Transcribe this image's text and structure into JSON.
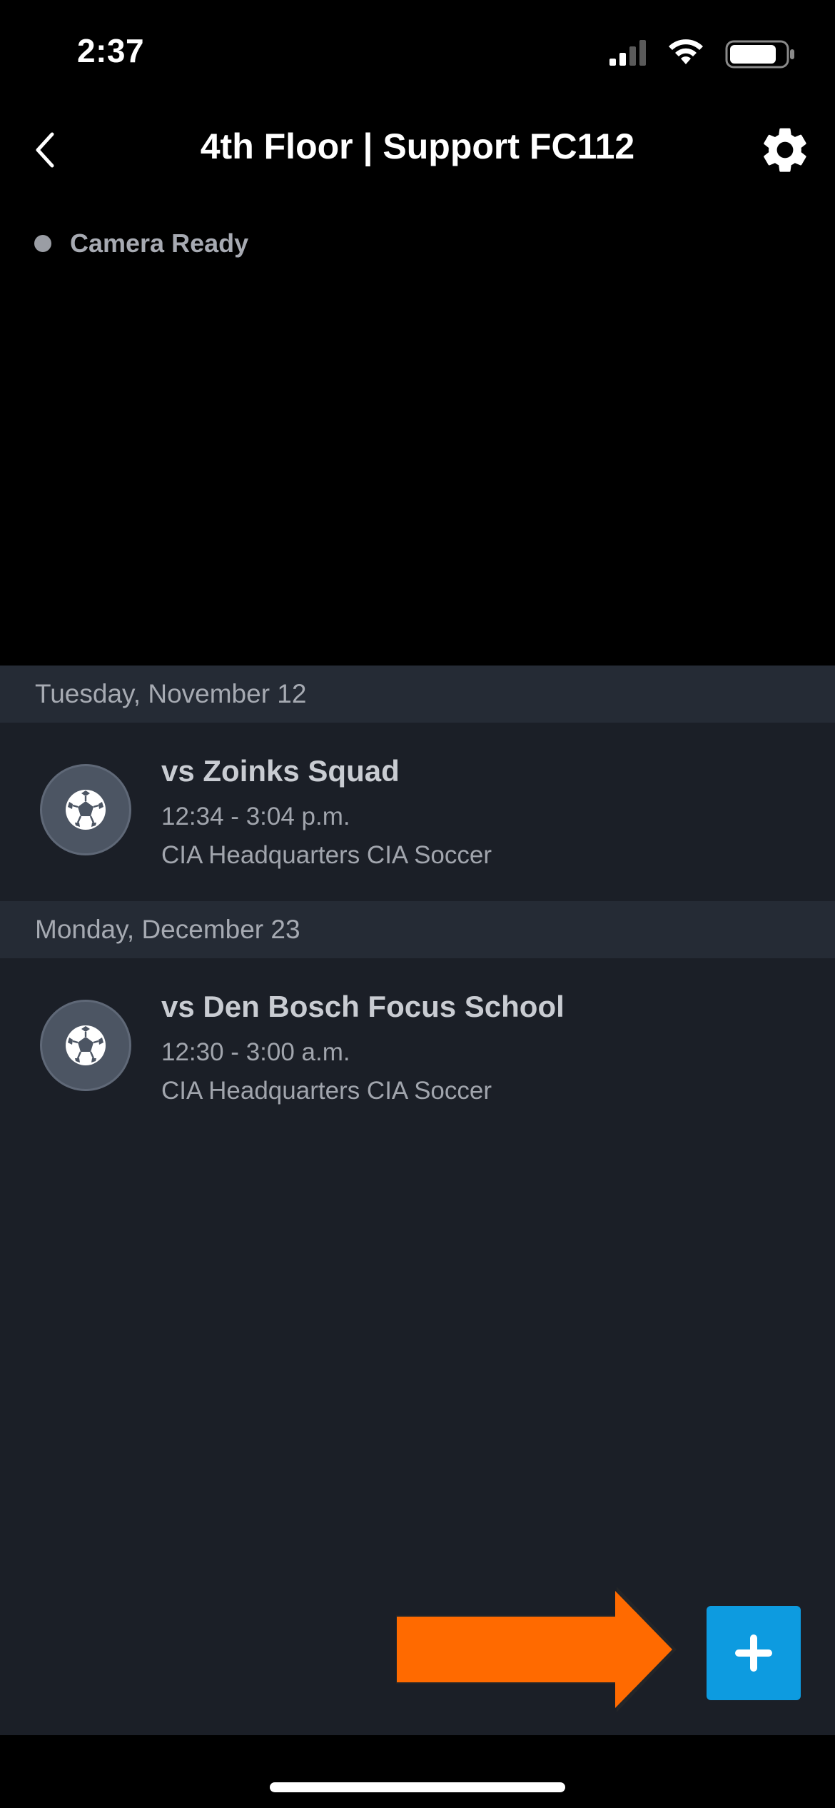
{
  "status_bar": {
    "time": "2:37"
  },
  "header": {
    "title": "4th Floor | Support FC112"
  },
  "camera": {
    "status": "Camera Ready",
    "status_color": "#9a9da4"
  },
  "events": [
    {
      "date": "Tuesday, November 12",
      "title": "vs Zoinks Squad",
      "time": "12:34 - 3:04 p.m.",
      "location": "CIA Headquarters CIA Soccer",
      "icon": "soccer-ball-icon"
    },
    {
      "date": "Monday, December 23",
      "title": "vs Den Bosch Focus School",
      "time": "12:30 - 3:00 a.m.",
      "location": "CIA Headquarters CIA Soccer",
      "icon": "soccer-ball-icon"
    }
  ],
  "colors": {
    "accent": "#0d9be0",
    "annotation_arrow": "#ff6a00",
    "list_background": "#1b1f27",
    "date_header_background": "#252b35"
  }
}
